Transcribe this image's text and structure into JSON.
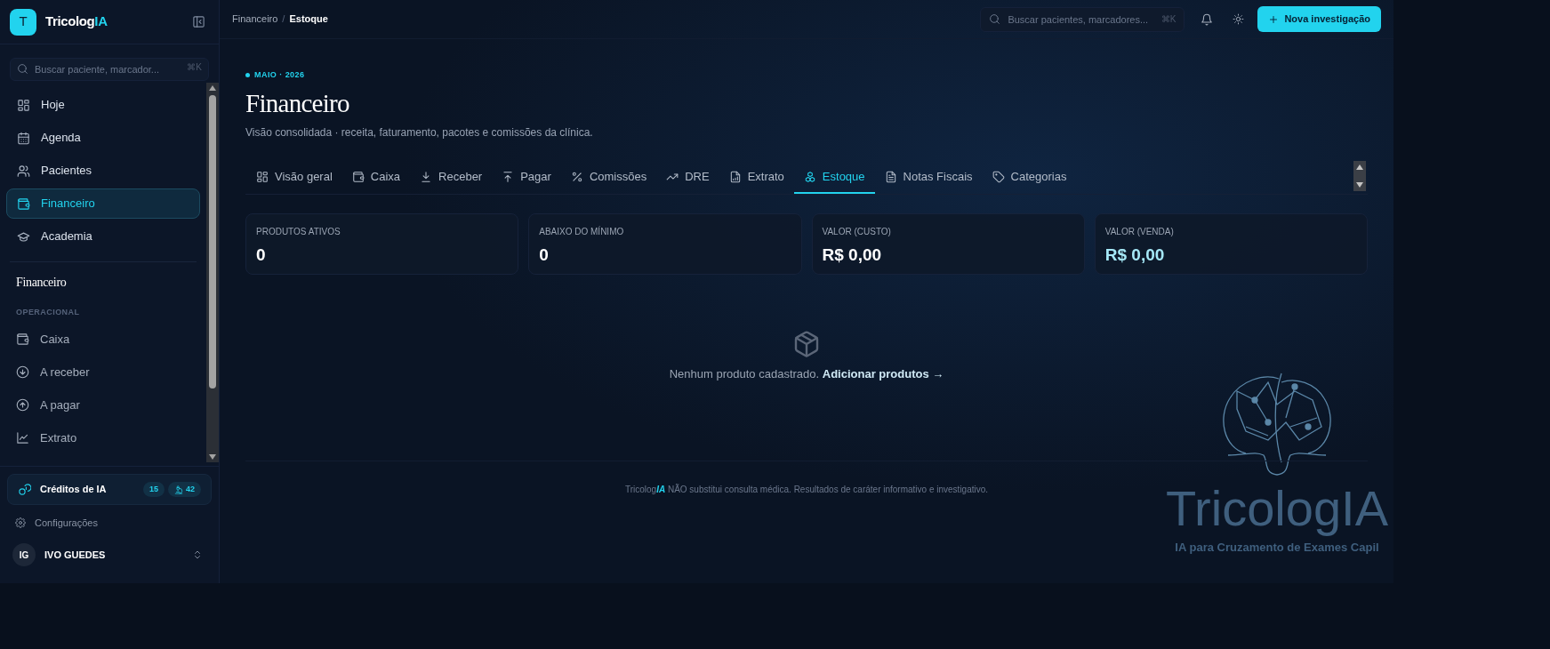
{
  "sidebar": {
    "brand": {
      "initial": "T",
      "name": "Tricolog",
      "name_accent": "IA"
    },
    "search": {
      "placeholder": "Buscar paciente, marcador...",
      "shortcut": "⌘K"
    },
    "nav": [
      {
        "label": "Hoje",
        "selected": false
      },
      {
        "label": "Agenda",
        "selected": false
      },
      {
        "label": "Pacientes",
        "selected": false
      },
      {
        "label": "Financeiro",
        "selected": true
      },
      {
        "label": "Academia",
        "selected": false
      }
    ],
    "section_title": "Financeiro",
    "group_label": "OPERACIONAL",
    "sub_nav": [
      {
        "label": "Caixa"
      },
      {
        "label": "A receber"
      },
      {
        "label": "A pagar"
      },
      {
        "label": "Extrato"
      }
    ],
    "credits": {
      "label": "Créditos de IA",
      "badges": [
        {
          "kind": "plain",
          "text": "15"
        },
        {
          "kind": "microscope",
          "text": "42"
        }
      ]
    },
    "settings": "Configurações",
    "user": {
      "initials": "IG",
      "name": "IVO GUEDES"
    }
  },
  "topbar": {
    "breadcrumb_separator": "/",
    "breadcrumb": [
      {
        "label": "Financeiro",
        "current": false
      },
      {
        "label": "Estoque",
        "current": true
      }
    ],
    "search": {
      "placeholder": "Buscar pacientes, marcadores...",
      "shortcut": "⌘K"
    },
    "primary_button": "Nova investigação"
  },
  "page": {
    "eyebrow": "MAIO · 2026",
    "title": "Financeiro",
    "subtitle": "Visão consolidada · receita, faturamento, pacotes e comissões da clínica.",
    "tabs": [
      {
        "label": "Visão geral",
        "selected": false
      },
      {
        "label": "Caixa",
        "selected": false
      },
      {
        "label": "Receber",
        "selected": false
      },
      {
        "label": "Pagar",
        "selected": false
      },
      {
        "label": "Comissões",
        "selected": false
      },
      {
        "label": "DRE",
        "selected": false
      },
      {
        "label": "Extrato",
        "selected": false
      },
      {
        "label": "Estoque",
        "selected": true
      },
      {
        "label": "Notas Fiscais",
        "selected": false
      },
      {
        "label": "Categorias",
        "selected": false
      }
    ],
    "stats": [
      {
        "label": "PRODUTOS ATIVOS",
        "value": "0",
        "kind": "plain"
      },
      {
        "label": "ABAIXO DO MÍNIMO",
        "value": "0",
        "kind": "plain"
      },
      {
        "label": "VALOR (CUSTO)",
        "value": "R$ 0,00",
        "kind": "plain"
      },
      {
        "label": "VALOR (VENDA)",
        "value": "R$ 0,00",
        "kind": "accent"
      }
    ],
    "empty": {
      "message": "Nenhum produto cadastrado.",
      "link": "Adicionar produtos →"
    },
    "footer": {
      "brand": "Tricolog",
      "brand_accent": "IA",
      "text": "NÃO substitui consulta médica. Resultados de caráter informativo e investigativo."
    }
  },
  "background_logo": {
    "name": "TricologIA",
    "tagline": "IA para Cruzamento de Exames Capil"
  }
}
